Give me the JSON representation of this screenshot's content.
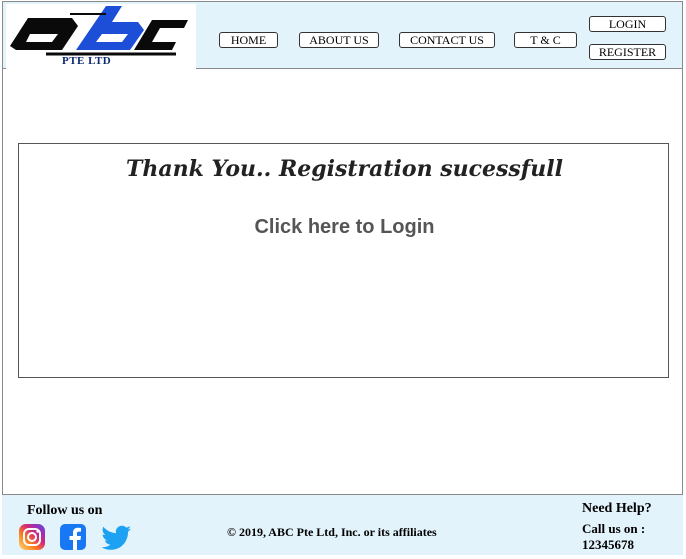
{
  "header": {
    "logo_subtitle": "PTE LTD",
    "nav": {
      "home": "HOME",
      "about": "ABOUT US",
      "contact": "CONTACT US",
      "terms": "T & C",
      "login": "LOGIN",
      "register": "REGISTER"
    }
  },
  "main": {
    "message": "Thank You.. Registration sucessfull",
    "login_link": "Click here to Login"
  },
  "footer": {
    "follow": "Follow us on",
    "social": [
      "instagram-icon",
      "facebook-icon",
      "twitter-icon"
    ],
    "copyright": "© 2019, ABC Pte Ltd, Inc. or its affiliates",
    "help_title": "Need Help?",
    "call_label": "Call us on :",
    "phone": "12345678"
  },
  "colors": {
    "header_bg": "#e3f3fb",
    "footer_bg": "#e3f3fb",
    "logo_blue": "#1d4ed8",
    "facebook": "#1877f2",
    "twitter": "#1da1f2"
  }
}
